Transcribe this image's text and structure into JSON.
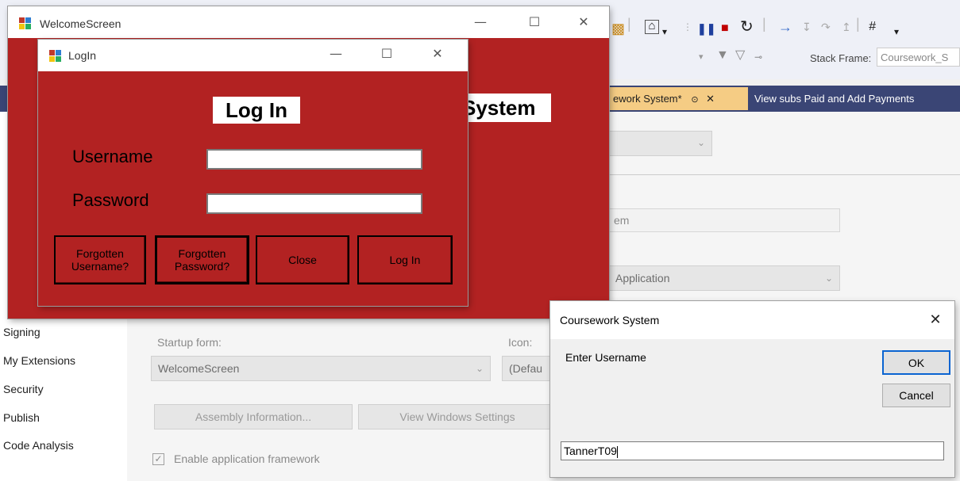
{
  "ide": {
    "toolbar": {
      "stack_frame_label": "Stack Frame:",
      "stack_frame_value": "Coursework_S",
      "icons": [
        "home-icon",
        "pause-icon",
        "stop-icon",
        "restart-icon",
        "step-into-icon",
        "step-over-icon",
        "step-out-icon",
        "hex-display-icon",
        "filter-icon"
      ]
    },
    "tabs": [
      {
        "label": "ework System*",
        "active": true
      },
      {
        "label": "View subs Paid and Add Payments",
        "active": false
      }
    ],
    "sidebar": {
      "items": [
        "Signing",
        "My Extensions",
        "Security",
        "Publish",
        "Code Analysis"
      ]
    },
    "application_page": {
      "assembly_name_fragment": "em",
      "app_type_fragment": "Application",
      "startup_form_label": "Startup form:",
      "startup_form_value": "WelcomeScreen",
      "icon_label": "Icon:",
      "icon_value": "(Defau",
      "assembly_info_button": "Assembly Information...",
      "view_windows_settings_button": "View Windows Settings",
      "enable_framework_label": "Enable application framework",
      "enable_framework_checked": true
    }
  },
  "welcome_window": {
    "title": "WelcomeScreen",
    "heading_fragment": "System",
    "background_color": "#b22222"
  },
  "login_window": {
    "title": "LogIn",
    "heading": "Log In",
    "username_label": "Username",
    "password_label": "Password",
    "username_value": "",
    "password_value": "",
    "buttons": {
      "forgot_username": "Forgotten Username?",
      "forgot_password": "Forgotten Password?",
      "close": "Close",
      "login": "Log In"
    }
  },
  "input_box": {
    "title": "Coursework System",
    "prompt": "Enter Username",
    "ok": "OK",
    "cancel": "Cancel",
    "value": "TannerT09"
  }
}
